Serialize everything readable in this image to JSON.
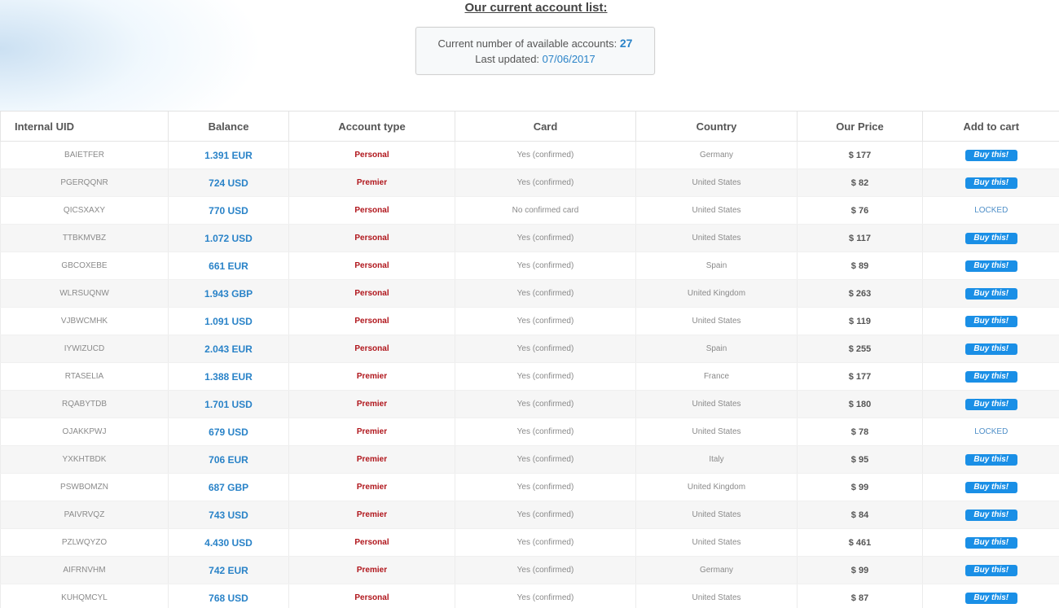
{
  "heading": "Our current account list:",
  "info": {
    "count_label": "Current number of available accounts:",
    "count_value": "27",
    "updated_label": "Last updated:",
    "updated_value": "07/06/2017"
  },
  "table": {
    "headers": [
      "Internal UID",
      "Balance",
      "Account type",
      "Card",
      "Country",
      "Our Price",
      "Add to cart"
    ],
    "buy_label": "Buy this!",
    "locked_label": "LOCKED",
    "rows": [
      {
        "uid": "BAIETFER",
        "balance": "1.391 EUR",
        "type": "Personal",
        "card": "Yes (confirmed)",
        "country": "Germany",
        "price": "$ 177",
        "cart": "buy"
      },
      {
        "uid": "PGERQQNR",
        "balance": "724 USD",
        "type": "Premier",
        "card": "Yes (confirmed)",
        "country": "United States",
        "price": "$ 82",
        "cart": "buy"
      },
      {
        "uid": "QICSXAXY",
        "balance": "770 USD",
        "type": "Personal",
        "card": "No confirmed card",
        "country": "United States",
        "price": "$ 76",
        "cart": "locked"
      },
      {
        "uid": "TTBKMVBZ",
        "balance": "1.072 USD",
        "type": "Personal",
        "card": "Yes (confirmed)",
        "country": "United States",
        "price": "$ 117",
        "cart": "buy"
      },
      {
        "uid": "GBCOXEBE",
        "balance": "661 EUR",
        "type": "Personal",
        "card": "Yes (confirmed)",
        "country": "Spain",
        "price": "$ 89",
        "cart": "buy"
      },
      {
        "uid": "WLRSUQNW",
        "balance": "1.943 GBP",
        "type": "Personal",
        "card": "Yes (confirmed)",
        "country": "United Kingdom",
        "price": "$ 263",
        "cart": "buy"
      },
      {
        "uid": "VJBWCMHK",
        "balance": "1.091 USD",
        "type": "Personal",
        "card": "Yes (confirmed)",
        "country": "United States",
        "price": "$ 119",
        "cart": "buy"
      },
      {
        "uid": "IYWIZUCD",
        "balance": "2.043 EUR",
        "type": "Personal",
        "card": "Yes (confirmed)",
        "country": "Spain",
        "price": "$ 255",
        "cart": "buy"
      },
      {
        "uid": "RTASELIA",
        "balance": "1.388 EUR",
        "type": "Premier",
        "card": "Yes (confirmed)",
        "country": "France",
        "price": "$ 177",
        "cart": "buy"
      },
      {
        "uid": "RQABYTDB",
        "balance": "1.701 USD",
        "type": "Premier",
        "card": "Yes (confirmed)",
        "country": "United States",
        "price": "$ 180",
        "cart": "buy"
      },
      {
        "uid": "OJAKKPWJ",
        "balance": "679 USD",
        "type": "Premier",
        "card": "Yes (confirmed)",
        "country": "United States",
        "price": "$ 78",
        "cart": "locked"
      },
      {
        "uid": "YXKHTBDK",
        "balance": "706 EUR",
        "type": "Premier",
        "card": "Yes (confirmed)",
        "country": "Italy",
        "price": "$ 95",
        "cart": "buy"
      },
      {
        "uid": "PSWBOMZN",
        "balance": "687 GBP",
        "type": "Premier",
        "card": "Yes (confirmed)",
        "country": "United Kingdom",
        "price": "$ 99",
        "cart": "buy"
      },
      {
        "uid": "PAIVRVQZ",
        "balance": "743 USD",
        "type": "Premier",
        "card": "Yes (confirmed)",
        "country": "United States",
        "price": "$ 84",
        "cart": "buy"
      },
      {
        "uid": "PZLWQYZO",
        "balance": "4.430 USD",
        "type": "Personal",
        "card": "Yes (confirmed)",
        "country": "United States",
        "price": "$ 461",
        "cart": "buy"
      },
      {
        "uid": "AIFRNVHM",
        "balance": "742 EUR",
        "type": "Premier",
        "card": "Yes (confirmed)",
        "country": "Germany",
        "price": "$ 99",
        "cart": "buy"
      },
      {
        "uid": "KUHQMCYL",
        "balance": "768 USD",
        "type": "Personal",
        "card": "Yes (confirmed)",
        "country": "United States",
        "price": "$ 87",
        "cart": "buy"
      }
    ]
  }
}
